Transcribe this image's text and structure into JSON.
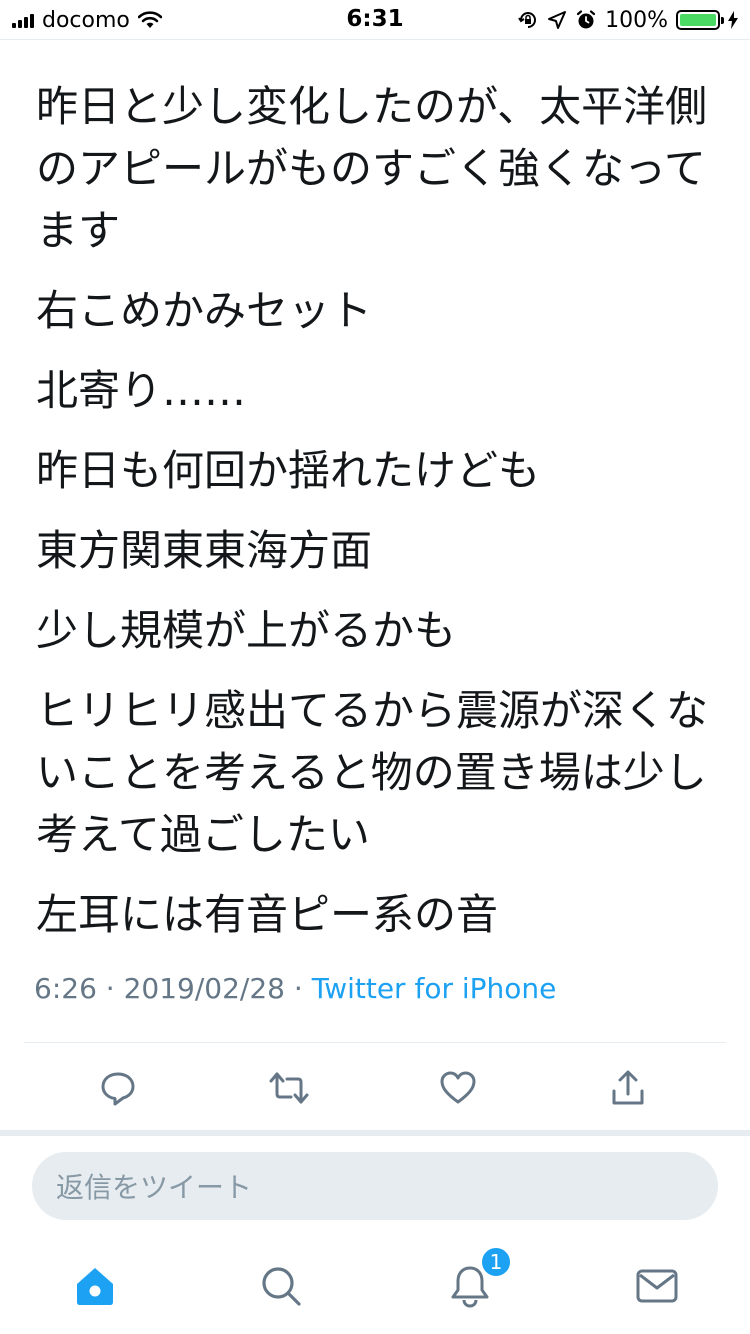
{
  "status_bar": {
    "carrier": "docomo",
    "time": "6:31",
    "battery_percent": "100%",
    "battery_level": 1.0,
    "icons": [
      "cellular-signal-icon",
      "wifi-icon",
      "orientation-lock-icon",
      "location-arrow-icon",
      "alarm-icon",
      "battery-icon",
      "charging-bolt-icon"
    ]
  },
  "tweet": {
    "paragraphs": [
      "昨日と少し変化したのが、太平洋側のアピールがものすごく強くなってます",
      "右こめかみセット",
      "北寄り……",
      "昨日も何回か揺れたけども",
      "東方関東東海方面",
      "少し規模が上がるかも",
      "ヒリヒリ感出てるから震源が深くないことを考えると物の置き場は少し考えて過ごしたい",
      "左耳には有音ピー系の音"
    ],
    "time": "6:26",
    "separator": "·",
    "date": "2019/02/28",
    "source": "Twitter for iPhone"
  },
  "actions": {
    "icons": [
      "reply-icon",
      "retweet-icon",
      "like-icon",
      "share-icon"
    ]
  },
  "reply": {
    "placeholder": "返信をツイート"
  },
  "tabs": {
    "icons": [
      "home-icon",
      "search-icon",
      "notifications-icon",
      "messages-icon"
    ],
    "notifications_badge": "1"
  },
  "colors": {
    "accent": "#1da1f2",
    "text": "#14171a",
    "secondary_text": "#657786",
    "divider": "#e6ecf0",
    "battery": "#4cd964"
  }
}
